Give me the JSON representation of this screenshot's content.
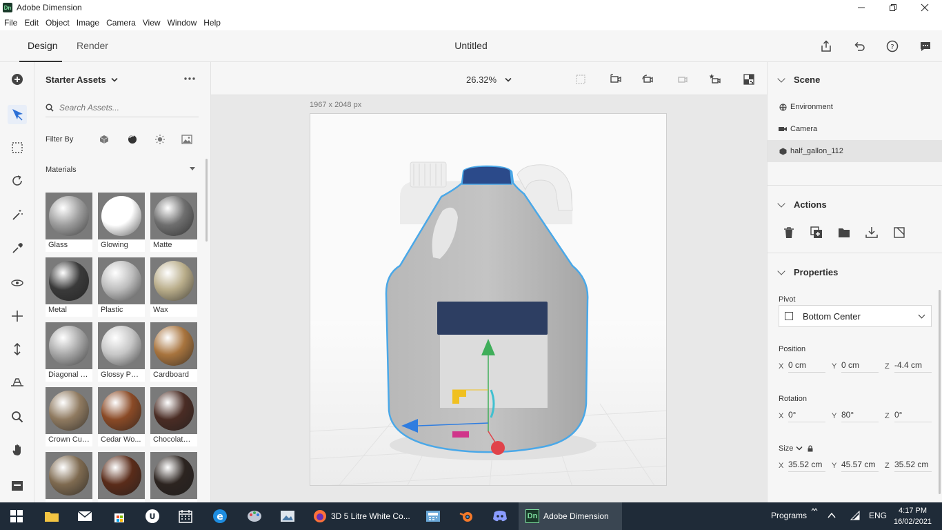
{
  "window": {
    "title": "Adobe Dimension",
    "logo_text": "Dn"
  },
  "menu": [
    "File",
    "Edit",
    "Object",
    "Image",
    "Camera",
    "View",
    "Window",
    "Help"
  ],
  "tabs": {
    "design": "Design",
    "render": "Render"
  },
  "document": {
    "title": "Untitled"
  },
  "assets": {
    "title": "Starter Assets",
    "search_placeholder": "Search Assets...",
    "filter_label": "Filter By",
    "section": "Materials",
    "materials": [
      {
        "label": "Glass",
        "color": "#9e9e9e"
      },
      {
        "label": "Glowing",
        "color": "#ffffff"
      },
      {
        "label": "Matte",
        "color": "#6f6f6f"
      },
      {
        "label": "Metal",
        "color": "#3a3a3a"
      },
      {
        "label": "Plastic",
        "color": "#bdbdbd"
      },
      {
        "label": "Wax",
        "color": "#b9ad8a"
      },
      {
        "label": "Diagonal P...",
        "color": "#a8a8a8"
      },
      {
        "label": "Glossy Pap...",
        "color": "#c6c6c6"
      },
      {
        "label": "Cardboard",
        "color": "#a8743e"
      },
      {
        "label": "Crown Cut...",
        "color": "#8f7a60"
      },
      {
        "label": "Cedar Wo...",
        "color": "#8a4a26"
      },
      {
        "label": "Chocolate ...",
        "color": "#4a2c24"
      },
      {
        "label": "",
        "color": "#7e6a50"
      },
      {
        "label": "",
        "color": "#5a2c1a"
      },
      {
        "label": "",
        "color": "#2c2420"
      }
    ]
  },
  "viewport": {
    "zoom": "26.32%",
    "dimensions": "1967 x 2048 px"
  },
  "scene": {
    "title": "Scene",
    "items": [
      "Environment",
      "Camera",
      "half_gallon_112"
    ]
  },
  "actions": {
    "title": "Actions"
  },
  "properties": {
    "title": "Properties",
    "pivot_label": "Pivot",
    "pivot_value": "Bottom Center",
    "position_label": "Position",
    "position": {
      "x": "0 cm",
      "y": "0 cm",
      "z": "-4.4 cm"
    },
    "rotation_label": "Rotation",
    "rotation": {
      "x": "0°",
      "y": "80°",
      "z": "0°"
    },
    "size_label": "Size",
    "size": {
      "x": "35.52 cm",
      "y": "45.57 cm",
      "z": "35.52 cm"
    }
  },
  "taskbar": {
    "apps": [
      "3D 5 Litre White Co...",
      "Adobe Dimension"
    ],
    "programs": "Programs",
    "language": "ENG",
    "time": "4:17 PM",
    "date": "16/02/2021"
  }
}
